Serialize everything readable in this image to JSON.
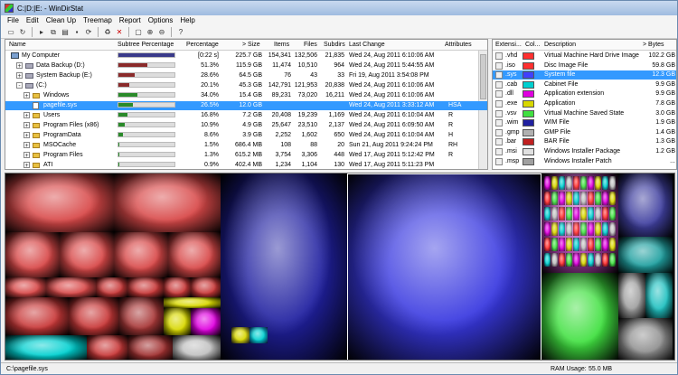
{
  "window": {
    "title": "C:|D:|E: - WinDirStat"
  },
  "menu": [
    "File",
    "Edit",
    "Clean Up",
    "Treemap",
    "Report",
    "Options",
    "Help"
  ],
  "dir_columns": [
    "Name",
    "Subtree Percentage",
    "Percentage",
    "> Size",
    "Items",
    "Files",
    "Subdirs",
    "Last Change",
    "Attributes"
  ],
  "dir_rows": [
    {
      "name": "My Computer",
      "level": 0,
      "bar": 1.0,
      "bar_color": "#3a3a8a",
      "pct": "[0:22 s]",
      "size": "225.7 GB",
      "items": "154,341",
      "files": "132,506",
      "subdirs": "21,835",
      "changed": "Wed 24, Aug 2011   6:10:06 AM",
      "attr": "",
      "expander": "",
      "icon": "computer"
    },
    {
      "name": "Data Backup (D:)",
      "level": 1,
      "bar": 0.513,
      "bar_color": "#8a2a2a",
      "pct": "51.3%",
      "size": "115.9 GB",
      "items": "11,474",
      "files": "10,510",
      "subdirs": "964",
      "changed": "Wed 24, Aug 2011   5:44:55 AM",
      "attr": "",
      "expander": "+",
      "icon": "drive"
    },
    {
      "name": "System Backup (E:)",
      "level": 1,
      "bar": 0.286,
      "bar_color": "#8a2a2a",
      "pct": "28.6%",
      "size": "64.5 GB",
      "items": "76",
      "files": "43",
      "subdirs": "33",
      "changed": "Fri 19, Aug 2011   3:54:08 PM",
      "attr": "",
      "expander": "+",
      "icon": "drive"
    },
    {
      "name": "(C:)",
      "level": 1,
      "bar": 0.201,
      "bar_color": "#8a2a2a",
      "pct": "20.1%",
      "size": "45.3 GB",
      "items": "142,791",
      "files": "121,953",
      "subdirs": "20,838",
      "changed": "Wed 24, Aug 2011   6:10:06 AM",
      "attr": "",
      "expander": "-",
      "icon": "drive"
    },
    {
      "name": "Windows",
      "level": 2,
      "bar": 0.34,
      "bar_color": "#2a8a2a",
      "pct": "34.0%",
      "size": "15.4 GB",
      "items": "89,231",
      "files": "73,020",
      "subdirs": "16,211",
      "changed": "Wed 24, Aug 2011   6:10:06 AM",
      "attr": "",
      "expander": "+",
      "icon": "folder"
    },
    {
      "name": "pagefile.sys",
      "level": 2,
      "bar": 0.265,
      "bar_color": "#2a8a2a",
      "pct": "26.5%",
      "size": "12.0 GB",
      "items": "",
      "files": "",
      "subdirs": "",
      "changed": "Wed 24, Aug 2011   3:33:12 AM",
      "attr": "HSA",
      "expander": "",
      "icon": "file",
      "selected": true
    },
    {
      "name": "Users",
      "level": 2,
      "bar": 0.168,
      "bar_color": "#2a8a2a",
      "pct": "16.8%",
      "size": "7.2 GB",
      "items": "20,408",
      "files": "19,239",
      "subdirs": "1,169",
      "changed": "Wed 24, Aug 2011   6:10:04 AM",
      "attr": "R",
      "expander": "+",
      "icon": "folder"
    },
    {
      "name": "Program Files (x86)",
      "level": 2,
      "bar": 0.109,
      "bar_color": "#2a8a2a",
      "pct": "10.9%",
      "size": "4.9 GB",
      "items": "25,647",
      "files": "23,510",
      "subdirs": "2,137",
      "changed": "Wed 24, Aug 2011   6:09:50 AM",
      "attr": "R",
      "expander": "+",
      "icon": "folder"
    },
    {
      "name": "ProgramData",
      "level": 2,
      "bar": 0.086,
      "bar_color": "#2a8a2a",
      "pct": "8.6%",
      "size": "3.9 GB",
      "items": "2,252",
      "files": "1,602",
      "subdirs": "650",
      "changed": "Wed 24, Aug 2011   6:10:04 AM",
      "attr": "H",
      "expander": "+",
      "icon": "folder"
    },
    {
      "name": "MSOCache",
      "level": 2,
      "bar": 0.015,
      "bar_color": "#2a8a2a",
      "pct": "1.5%",
      "size": "686.4 MB",
      "items": "108",
      "files": "88",
      "subdirs": "20",
      "changed": "Sun 21, Aug 2011   9:24:24 PM",
      "attr": "RH",
      "expander": "+",
      "icon": "folder"
    },
    {
      "name": "Program Files",
      "level": 2,
      "bar": 0.013,
      "bar_color": "#2a8a2a",
      "pct": "1.3%",
      "size": "615.2 MB",
      "items": "3,754",
      "files": "3,306",
      "subdirs": "448",
      "changed": "Wed 17, Aug 2011   5:12:42 PM",
      "attr": "R",
      "expander": "+",
      "icon": "folder"
    },
    {
      "name": "ATI",
      "level": 2,
      "bar": 0.009,
      "bar_color": "#2a8a2a",
      "pct": "0.9%",
      "size": "402.4 MB",
      "items": "1,234",
      "files": "1,104",
      "subdirs": "130",
      "changed": "Wed 17, Aug 2011   5:11:23 PM",
      "attr": "",
      "expander": "+",
      "icon": "folder"
    }
  ],
  "ext_columns": [
    "Extensi...",
    "Col...",
    "Description",
    "> Bytes"
  ],
  "ext_rows": [
    {
      "ext": ".vhd",
      "color": "#ff3030",
      "desc": "Virtual Machine Hard Drive Image",
      "bytes": "102.2 GB"
    },
    {
      "ext": ".iso",
      "color": "#ff3030",
      "desc": "Disc Image File",
      "bytes": "59.8 GB"
    },
    {
      "ext": ".sys",
      "color": "#4040ff",
      "desc": "System file",
      "bytes": "12.3 GB",
      "selected": true
    },
    {
      "ext": ".cab",
      "color": "#00d0d0",
      "desc": "Cabinet File",
      "bytes": "9.9 GB"
    },
    {
      "ext": ".dll",
      "color": "#e000e0",
      "desc": "Application extension",
      "bytes": "9.9 GB"
    },
    {
      "ext": ".exe",
      "color": "#d8d800",
      "desc": "Application",
      "bytes": "7.8 GB"
    },
    {
      "ext": ".vsv",
      "color": "#40e040",
      "desc": "Virtual Machine Saved State",
      "bytes": "3.0 GB"
    },
    {
      "ext": ".wim",
      "color": "#2020a0",
      "desc": "WIM File",
      "bytes": "1.9 GB"
    },
    {
      "ext": ".gmp",
      "color": "#b0b0b0",
      "desc": "GMP File",
      "bytes": "1.4 GB"
    },
    {
      "ext": ".bar",
      "color": "#c02020",
      "desc": "BAR File",
      "bytes": "1.3 GB"
    },
    {
      "ext": ".msi",
      "color": "#e0e0e0",
      "desc": "Windows Installer Package",
      "bytes": "1.2 GB"
    },
    {
      "ext": ".msp",
      "color": "#a0a0a0",
      "desc": "Windows Installer Patch",
      "bytes": "..."
    }
  ],
  "status": {
    "path": "C:\\pagefile.sys",
    "ram_label": "RAM Usage:",
    "ram_value": "55.0 MB"
  }
}
